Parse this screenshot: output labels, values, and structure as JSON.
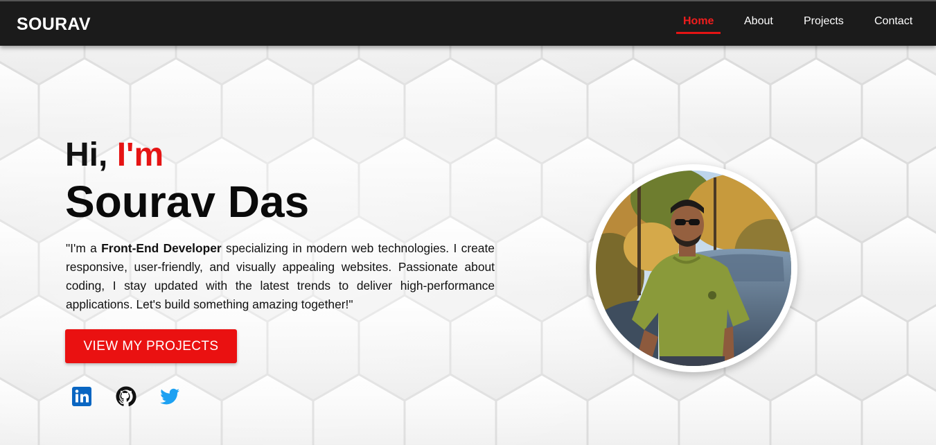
{
  "navbar": {
    "brand": "SOURAV",
    "links": [
      {
        "label": "Home",
        "active": true
      },
      {
        "label": "About",
        "active": false
      },
      {
        "label": "Projects",
        "active": false
      },
      {
        "label": "Contact",
        "active": false
      }
    ]
  },
  "hero": {
    "greeting_prefix": "Hi,",
    "greeting_accent": "I'm",
    "name": "Sourav Das",
    "bio_open": "\"I'm a",
    "bio_strong": "Front-End Developer",
    "bio_rest": "specializing in modern web technologies. I create responsive, user-friendly, and visually appealing websites. Passionate about coding, I stay updated with the latest trends to deliver high-performance applications. Let's build something amazing together!\"",
    "cta_label": "VIEW MY PROJECTS"
  },
  "social": [
    {
      "icon": "linkedin-icon",
      "color": "#0a66c2"
    },
    {
      "icon": "github-icon",
      "color": "#111111"
    },
    {
      "icon": "twitter-icon",
      "color": "#1da1f2"
    }
  ],
  "colors": {
    "accent": "#e51414",
    "navbar_bg": "#1b1b1b",
    "page_bg": "#f4f4f4"
  }
}
